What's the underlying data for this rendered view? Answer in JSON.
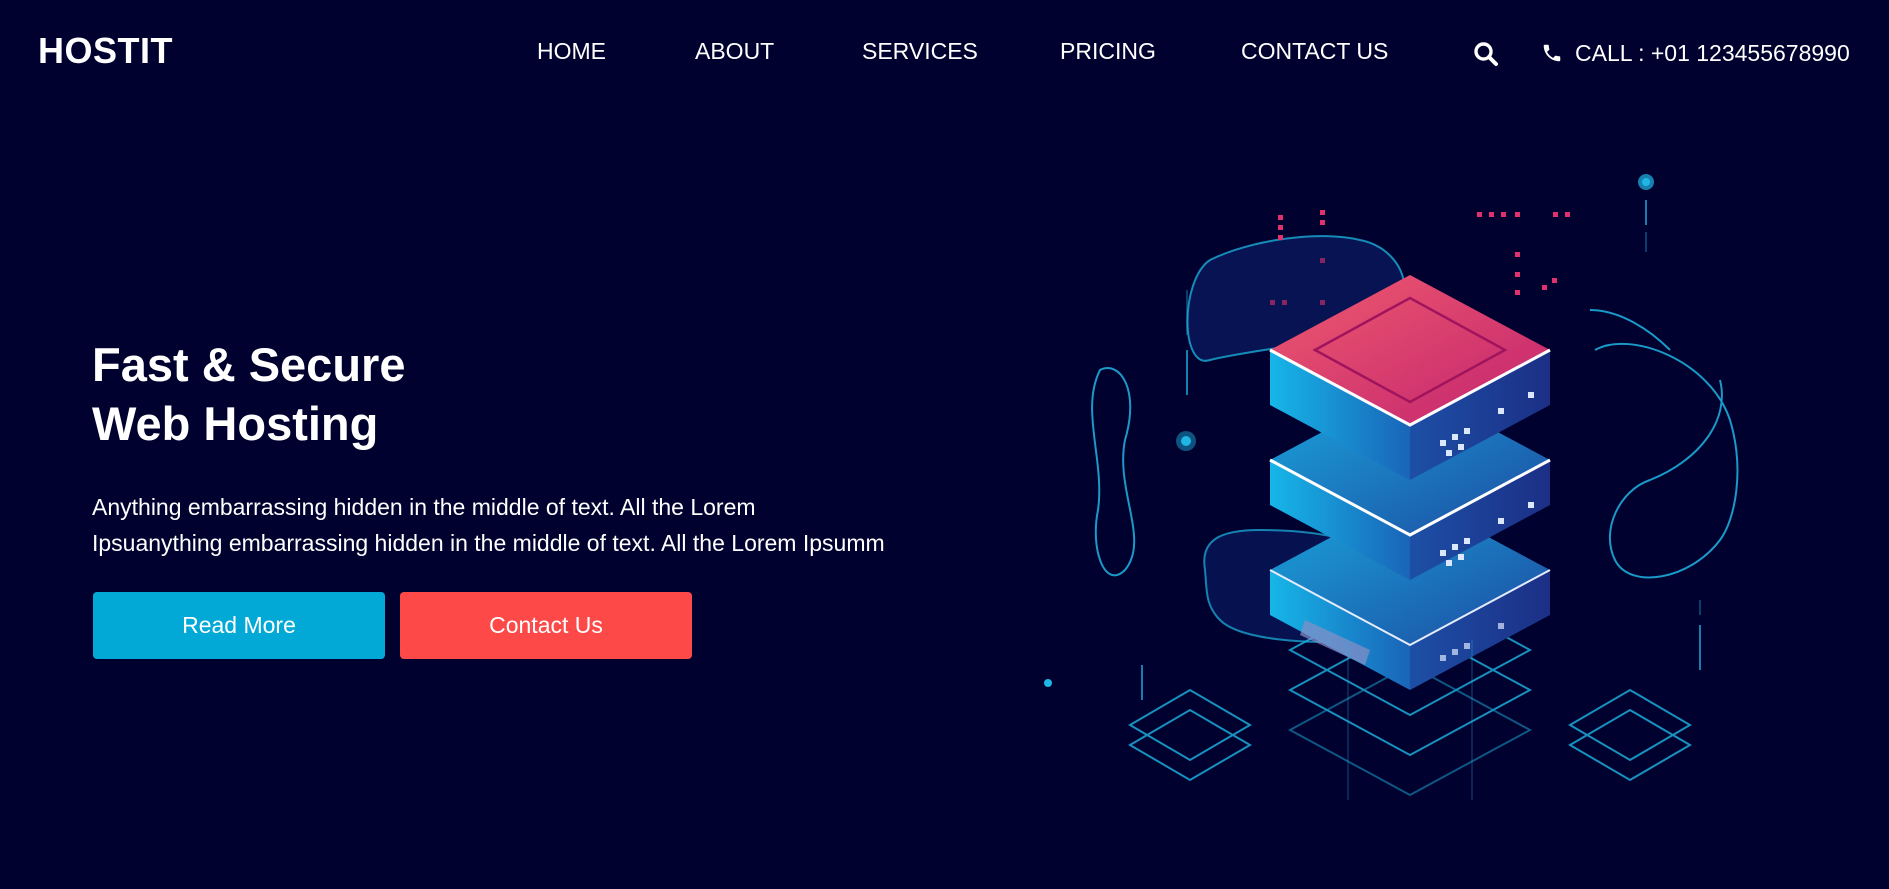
{
  "brand": {
    "name": "HOSTIT"
  },
  "nav": {
    "items": [
      {
        "label": "HOME"
      },
      {
        "label": "ABOUT"
      },
      {
        "label": "SERVICES"
      },
      {
        "label": "PRICING"
      },
      {
        "label": "CONTACT US"
      }
    ]
  },
  "header": {
    "search_icon": "search-icon",
    "call_icon": "phone-icon",
    "call_label": "CALL : +01 123455678990"
  },
  "hero": {
    "title_line1": "Fast & Secure",
    "title_line2": "Web Hosting",
    "text_line1": "Anything embarrassing hidden in the middle of text. All the Lorem",
    "text_line2": "Ipsuanything embarrassing hidden in the middle of text. All the Lorem Ipsumm",
    "read_more_label": "Read More",
    "contact_label": "Contact Us"
  },
  "colors": {
    "background": "#01012f",
    "primary_button": "#03a9d6",
    "secondary_button": "#fe4949",
    "accent_cyan": "#1fb6e4",
    "accent_pink": "#e0306d"
  }
}
